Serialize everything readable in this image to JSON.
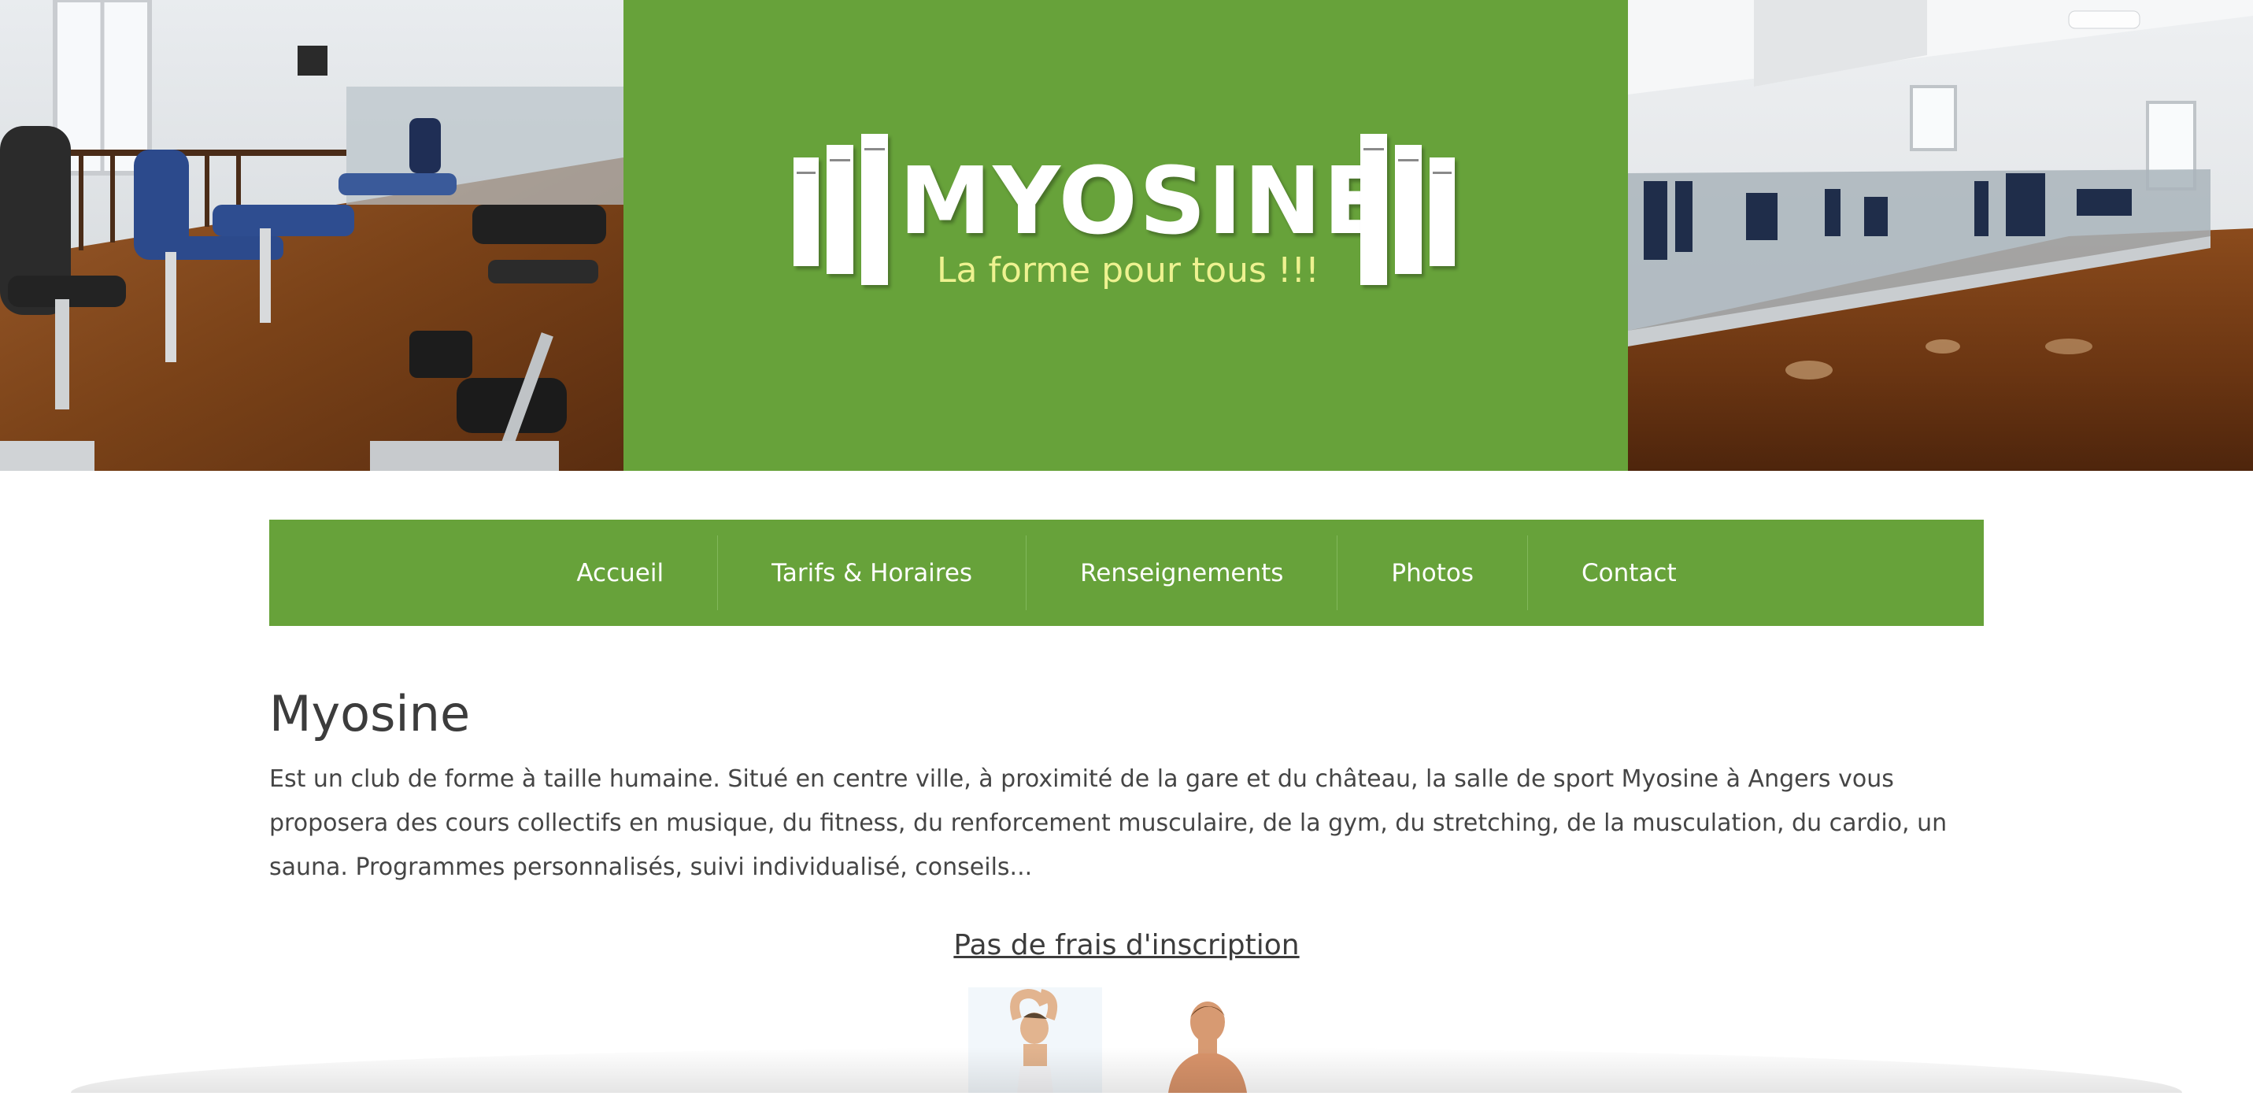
{
  "brand": {
    "name": "MYOSINE",
    "tagline": "La forme pour tous !!!",
    "green": "#67a23a",
    "tagline_color": "#eef290"
  },
  "nav": {
    "items": [
      {
        "label": "Accueil"
      },
      {
        "label": "Tarifs & Horaires"
      },
      {
        "label": "Renseignements"
      },
      {
        "label": "Photos"
      },
      {
        "label": "Contact"
      }
    ]
  },
  "main": {
    "title": "Myosine",
    "intro": "Est un club de forme à taille humaine. Situé en centre ville, à proximité de la gare et du château, la salle de sport Myosine à Angers vous proposera des cours collectifs en musique, du fitness, du renforcement musculaire, de la gym, du stretching, de la musculation, du cardio, un sauna. Programmes personnalisés, suivi individualisé, conseils...",
    "promo_link": "Pas de frais d'inscription"
  },
  "images": {
    "left_photo": "gym-machines-photo",
    "right_photo": "gym-hall-photo",
    "bottom": "people-fitness-photo"
  }
}
